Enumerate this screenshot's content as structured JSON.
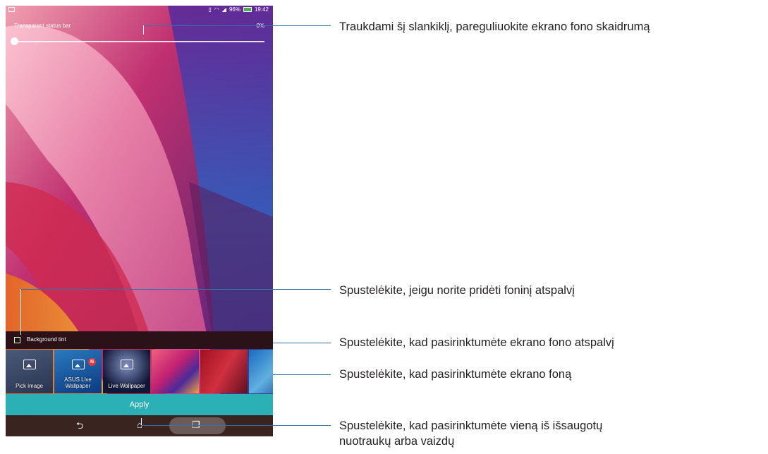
{
  "status_bar": {
    "battery": "96%",
    "time": "19:42",
    "icons": [
      "image-notification-icon",
      "vibrate-icon",
      "wifi-icon",
      "signal-icon",
      "battery-icon"
    ]
  },
  "slider": {
    "label": "Transparent status bar",
    "value_text": "0%",
    "value_fraction": 0.0
  },
  "tint": {
    "label": "Background tint",
    "checked": false
  },
  "thumbnails": [
    {
      "label": "Pick image",
      "icon": "image-icon"
    },
    {
      "label": "ASUS Live Wallpaper",
      "icon": "live-wallpaper-icon",
      "badge": "N"
    },
    {
      "label": "Live Wallpaper",
      "icon": "live-wallpaper-icon"
    },
    {
      "label": ""
    },
    {
      "label": ""
    },
    {
      "label": ""
    }
  ],
  "apply_label": "Apply",
  "nav": {
    "back_glyph": "⮌",
    "home_glyph": "⌂",
    "recent_glyph": "❐"
  },
  "callouts": {
    "c1": "Traukdami šį slankiklį, pareguliuokite ekrano fono skaidrumą",
    "c2": "Spustelėkite, jeigu norite pridėti foninį atspalvį",
    "c3": "Spustelėkite, kad pasirinktumėte ekrano fono atspalvį",
    "c4": "Spustelėkite, kad pasirinktumėte ekrano foną",
    "c5_line1": "Spustelėkite, kad pasirinktumėte vieną iš išsaugotų",
    "c5_line2": "nuotraukų arba vaizdų"
  },
  "colors": {
    "accent": "#2bb0b6",
    "callout_line": "#3b6ea5",
    "badge": "#e53935"
  }
}
